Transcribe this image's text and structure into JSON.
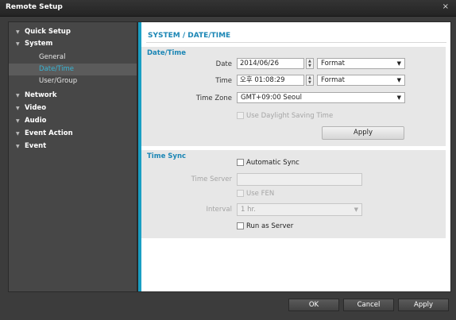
{
  "window": {
    "title": "Remote Setup",
    "close_glyph": "×"
  },
  "sidebar": {
    "items": [
      {
        "label": "Quick Setup",
        "level": 0
      },
      {
        "label": "System",
        "level": 0
      },
      {
        "label": "General",
        "level": 1
      },
      {
        "label": "Date/Time",
        "level": 1,
        "selected": true
      },
      {
        "label": "User/Group",
        "level": 1
      },
      {
        "label": "Network",
        "level": 0
      },
      {
        "label": "Video",
        "level": 0
      },
      {
        "label": "Audio",
        "level": 0
      },
      {
        "label": "Event Action",
        "level": 0
      },
      {
        "label": "Event",
        "level": 0
      }
    ],
    "expander_glyph": "▼",
    "selected_color": "#38b4d4"
  },
  "main": {
    "heading": "SYSTEM / DATE/TIME",
    "accent_color": "#1a9fc3",
    "datetime": {
      "title": "Date/Time",
      "date_label": "Date",
      "date_value": "2014/06/26",
      "date_format": "Format",
      "time_label": "Time",
      "time_value": "오후 01:08:29",
      "time_format": "Format",
      "tz_label": "Time Zone",
      "tz_value": "GMT+09:00 Seoul",
      "dst_label": "Use Daylight Saving Time",
      "dst_checked": false,
      "apply_label": "Apply"
    },
    "timesync": {
      "title": "Time Sync",
      "auto_label": "Automatic Sync",
      "auto_checked": false,
      "server_label": "Time Server",
      "server_value": "",
      "fen_label": "Use FEN",
      "interval_label": "Interval",
      "interval_value": "1 hr.",
      "run_server_label": "Run as Server",
      "run_server_checked": false
    }
  },
  "footer": {
    "ok": "OK",
    "cancel": "Cancel",
    "apply": "Apply"
  }
}
